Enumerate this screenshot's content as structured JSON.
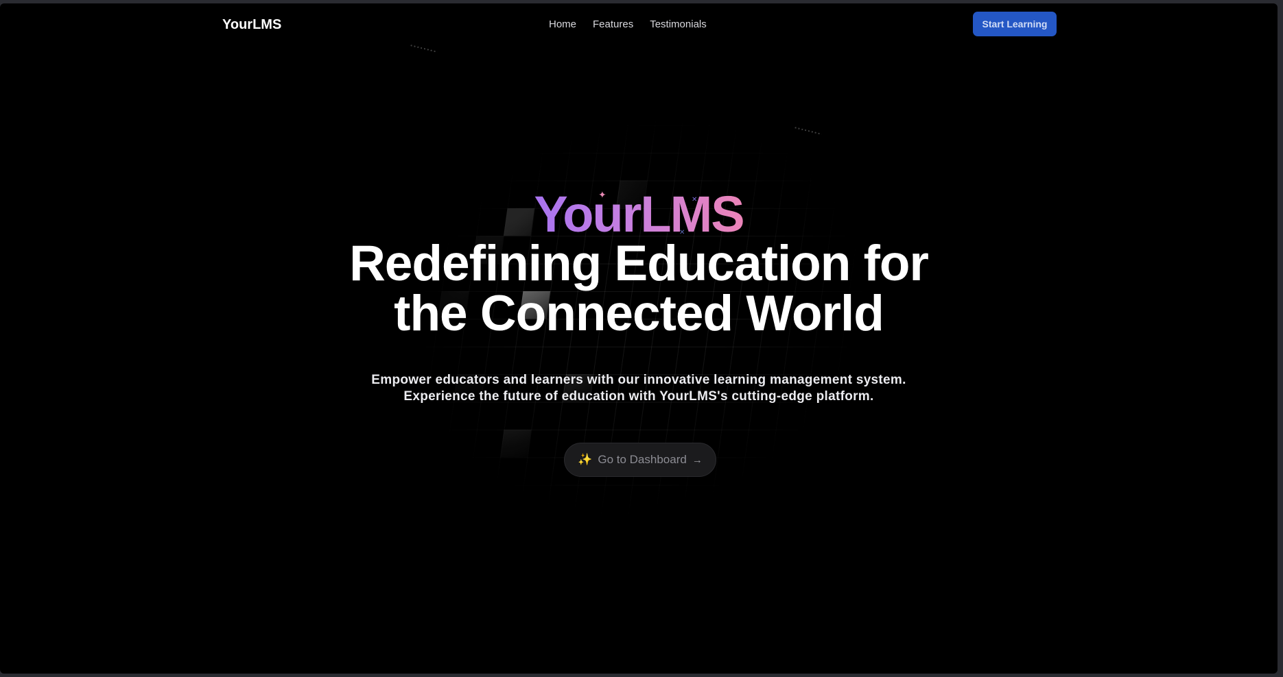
{
  "nav": {
    "brand": "YourLMS",
    "links": [
      "Home",
      "Features",
      "Testimonials"
    ],
    "cta_label": "Start Learning"
  },
  "hero": {
    "brand": "YourLMS",
    "headline_line1": "Redefining Education for",
    "headline_line2": "the Connected World",
    "subtitle_line1": "Empower educators and learners with our innovative learning management system.",
    "subtitle_line2": "Experience the future of education with YourLMS's cutting-edge platform.",
    "dashboard_icon": "✨",
    "dashboard_label": "Go to Dashboard",
    "dashboard_arrow": "→"
  },
  "colors": {
    "background": "#000000",
    "cta": "#2457c5",
    "gradient_start": "#a874f0",
    "gradient_end": "#ec84b8"
  }
}
